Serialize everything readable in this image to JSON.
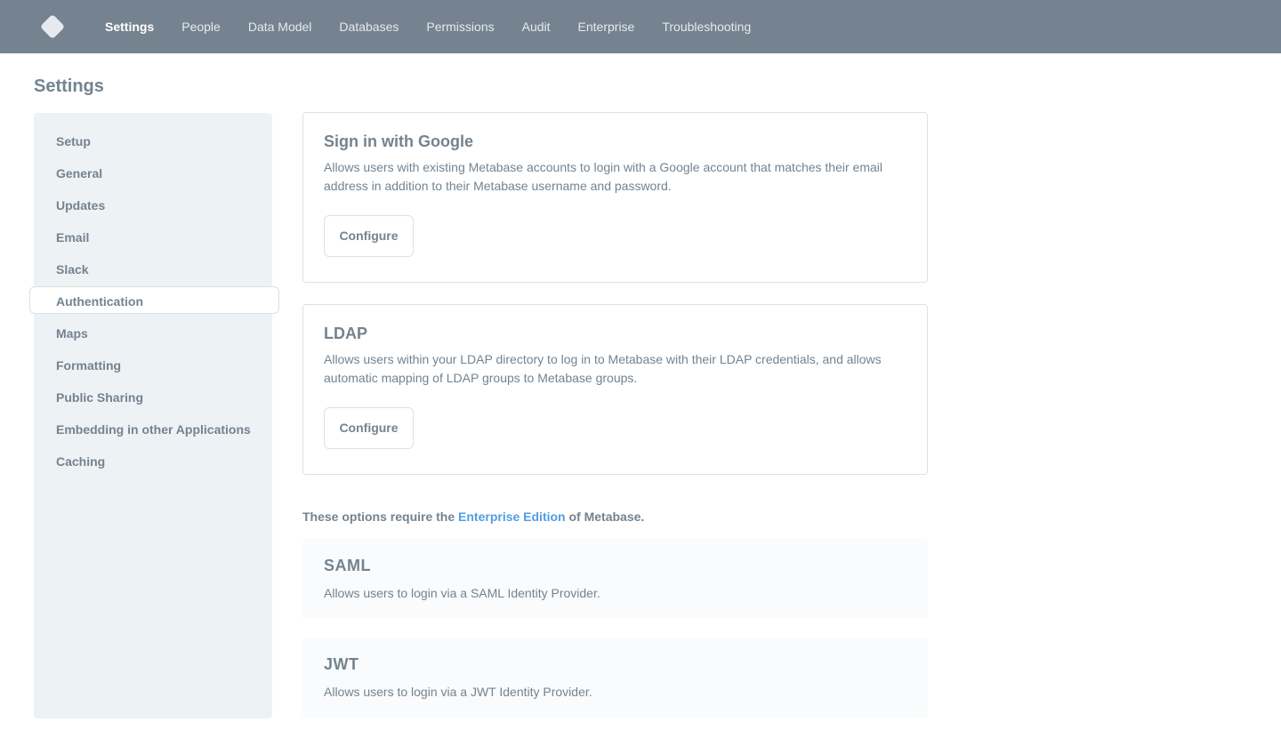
{
  "nav": {
    "items": [
      {
        "label": "Settings",
        "active": true
      },
      {
        "label": "People"
      },
      {
        "label": "Data Model"
      },
      {
        "label": "Databases"
      },
      {
        "label": "Permissions"
      },
      {
        "label": "Audit"
      },
      {
        "label": "Enterprise"
      },
      {
        "label": "Troubleshooting"
      }
    ]
  },
  "page": {
    "title": "Settings"
  },
  "sidebar": {
    "items": [
      {
        "label": "Setup"
      },
      {
        "label": "General"
      },
      {
        "label": "Updates"
      },
      {
        "label": "Email"
      },
      {
        "label": "Slack"
      },
      {
        "label": "Authentication",
        "active": true
      },
      {
        "label": "Maps"
      },
      {
        "label": "Formatting"
      },
      {
        "label": "Public Sharing"
      },
      {
        "label": "Embedding in other Applications"
      },
      {
        "label": "Caching"
      }
    ]
  },
  "auth": {
    "google": {
      "title": "Sign in with Google",
      "description": "Allows users with existing Metabase accounts to login with a Google account that matches their email address in addition to their Metabase username and password.",
      "button": "Configure"
    },
    "ldap": {
      "title": "LDAP",
      "description": "Allows users within your LDAP directory to log in to Metabase with their LDAP credentials, and allows automatic mapping of LDAP groups to Metabase groups.",
      "button": "Configure"
    },
    "enterprise_note": {
      "prefix": "These options require the",
      "link": "Enterprise Edition",
      "suffix": "of Metabase."
    },
    "saml": {
      "title": "SAML",
      "description": "Allows users to login via a SAML Identity Provider."
    },
    "jwt": {
      "title": "JWT",
      "description": "Allows users to login via a JWT Identity Provider."
    }
  },
  "colors": {
    "nav_bg": "#74838f",
    "sidebar_bg": "#edf2f5",
    "link": "#509ee3",
    "text": "#74838f"
  },
  "icons": {
    "logo": "metabase-logo-icon"
  }
}
